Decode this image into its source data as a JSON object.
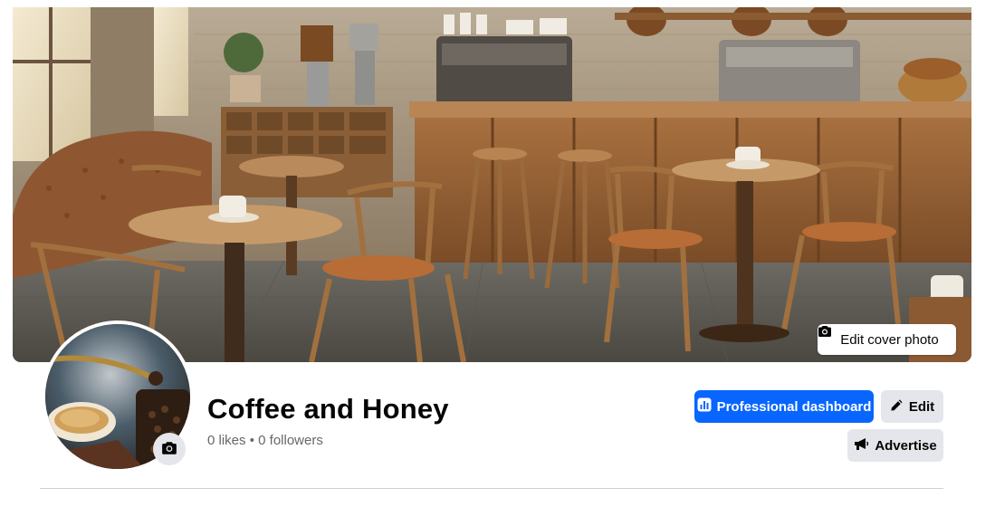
{
  "cover": {
    "edit_cover_label": "Edit cover photo",
    "edit_cover_icon": "camera-icon",
    "scene": "cafe-interior-illustration"
  },
  "avatar": {
    "scene": "coffee-grinder-and-cup",
    "change_photo_icon": "camera-icon"
  },
  "profile": {
    "name": "Coffee and Honey",
    "likes": "0 likes",
    "separator": "•",
    "followers": "0 followers"
  },
  "actions": {
    "dashboard_label": "Professional dashboard",
    "dashboard_icon": "bar-chart-icon",
    "edit_label": "Edit",
    "edit_icon": "pencil-icon",
    "advertise_label": "Advertise",
    "advertise_icon": "megaphone-icon"
  },
  "colors": {
    "primary": "#0866ff",
    "secondary_bg": "#e4e6eb",
    "text": "#050505",
    "muted": "#65676b"
  }
}
